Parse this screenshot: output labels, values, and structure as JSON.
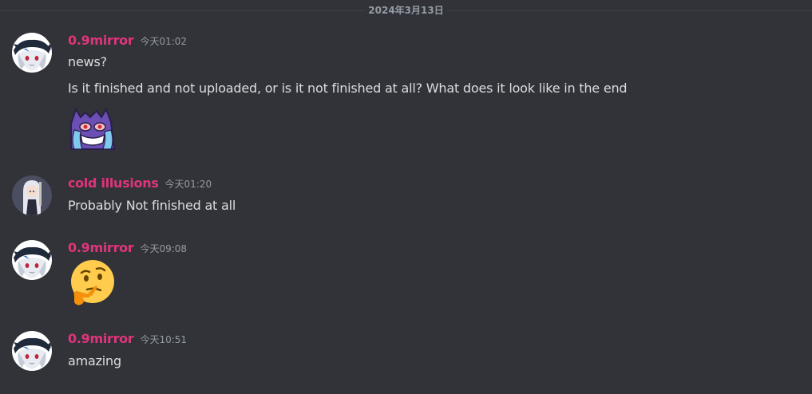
{
  "date_divider": "2024年3月13日",
  "messages": [
    {
      "username": "0.9mirror",
      "timestamp": "今天01:02",
      "lines": [
        "news?",
        "Is it finished and not uploaded, or is it not finished at all? What does it look like in the end"
      ],
      "attachment": "crying-gengar-sticker"
    },
    {
      "username": "cold illusions",
      "timestamp": "今天01:20",
      "lines": [
        "Probably Not finished at all"
      ]
    },
    {
      "username": "0.9mirror",
      "timestamp": "今天09:08",
      "attachment": "thinking-face-emoji"
    },
    {
      "username": "0.9mirror",
      "timestamp": "今天10:51",
      "lines": [
        "amazing"
      ]
    }
  ],
  "colors": {
    "background": "#313338",
    "username": "#e0347b",
    "text": "#dbdee1",
    "muted": "#949ba4",
    "divider": "#3f4147"
  }
}
